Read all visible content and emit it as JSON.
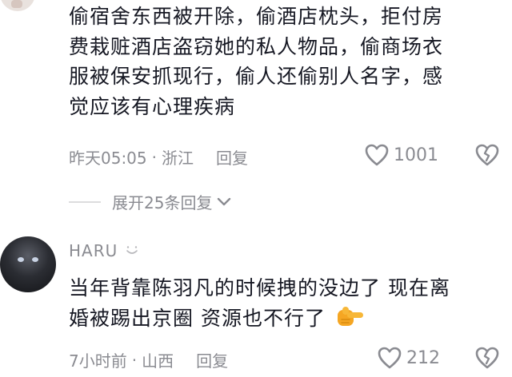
{
  "comments": [
    {
      "text_lines": [
        "偷宿舍东西被开除，偷酒店枕头，拒付房",
        "费栽赃酒店盗窃她的私人物品，偷商场衣",
        "服被保安抓现行，偷人还偷别人名字，感",
        "觉应该有心理疾病"
      ],
      "time": "昨天05:05",
      "separator": "·",
      "location": "浙江",
      "reply_label": "回复",
      "like_count": "1001"
    },
    {
      "username": "HARU",
      "text_lines": [
        "当年背靠陈羽凡的时候拽的没边了 现在离",
        "婚被踢出京圈 资源也不行了"
      ],
      "time": "7小时前",
      "separator": "·",
      "location": "山西",
      "reply_label": "回复",
      "like_count": "212"
    }
  ],
  "expand_replies": {
    "label": "展开25条回复"
  },
  "icons": {
    "like": "heart-icon",
    "dislike": "broken-heart-icon",
    "expand": "chevron-down-icon",
    "emoji": "pointing-hand-emoji"
  },
  "colors": {
    "text": "#161823",
    "meta": "#8a8b91",
    "emoji": "#f5a623"
  }
}
